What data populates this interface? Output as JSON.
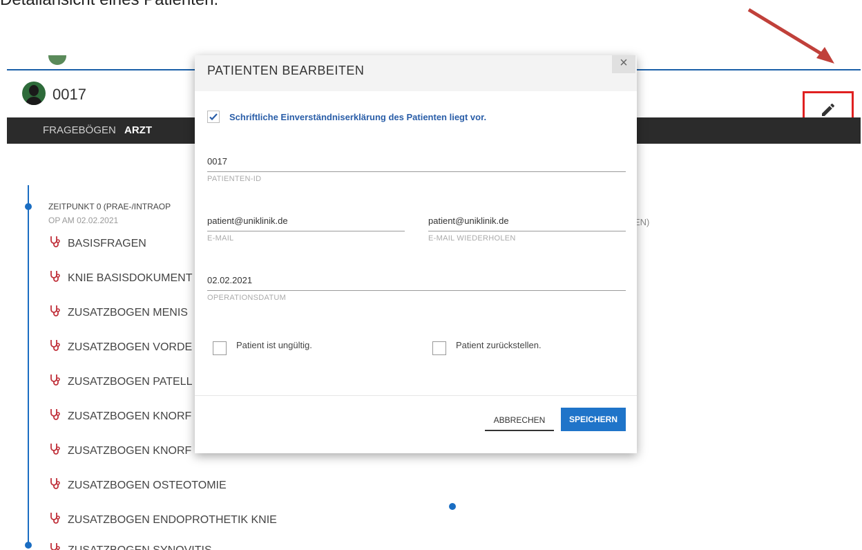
{
  "caption": "Detailansicht eines Patienten.",
  "patient": {
    "id": "0017"
  },
  "nav": {
    "tabs": [
      {
        "label": "FRAGEBÖGEN"
      },
      {
        "label": "ARZT"
      }
    ]
  },
  "timeline": {
    "timepoint_title": "ZEITPUNKT 0 (PRAE-/INTRAOP",
    "timepoint_sub": "OP AM 02.02.2021",
    "right_fragment": "EN)",
    "items": [
      {
        "label": "BASISFRAGEN"
      },
      {
        "label": "KNIE BASISDOKUMENT"
      },
      {
        "label": "ZUSATZBOGEN MENIS"
      },
      {
        "label": "ZUSATZBOGEN VORDE"
      },
      {
        "label": "ZUSATZBOGEN PATELL"
      },
      {
        "label": "ZUSATZBOGEN KNORF"
      },
      {
        "label": "ZUSATZBOGEN KNORF"
      },
      {
        "label": "ZUSATZBOGEN OSTEOTOMIE"
      },
      {
        "label": "ZUSATZBOGEN ENDOPROTHETIK KNIE"
      },
      {
        "label": "ZUSATZBOGEN SYNOVITIS"
      }
    ]
  },
  "modal": {
    "title": "PATIENTEN BEARBEITEN",
    "close": "×",
    "consent": {
      "label": "Schriftliche Einverständniserklärung des Patienten liegt vor.",
      "checked": true
    },
    "fields": {
      "patient_id": {
        "value": "0017",
        "label": "PATIENTEN-ID"
      },
      "email": {
        "value": "patient@uniklinik.de",
        "label": "E-MAIL"
      },
      "email_repeat": {
        "value": "patient@uniklinik.de",
        "label": "E-MAIL WIEDERHOLEN"
      },
      "op_date": {
        "value": "02.02.2021",
        "label": "OPERATIONSDATUM"
      }
    },
    "options": {
      "invalid": {
        "label": "Patient ist ungültig.",
        "checked": false
      },
      "defer": {
        "label": "Patient zurückstellen.",
        "checked": false
      }
    },
    "buttons": {
      "cancel": "ABBRECHEN",
      "save": "SPEICHERN"
    }
  },
  "colors": {
    "accent": "#1f74c9",
    "navbar": "#2b2b2b",
    "highlight_box": "#e02020",
    "arrow": "#c0403a",
    "timeline": "#1a6dc2"
  }
}
